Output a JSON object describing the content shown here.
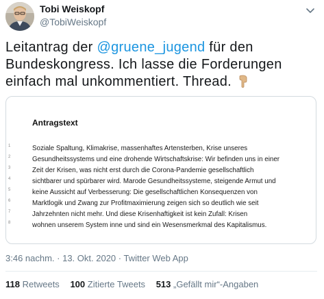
{
  "user": {
    "name": "Tobi Weiskopf",
    "handle": "@TobiWeiskopf"
  },
  "tweet": {
    "text_before": "Leitantrag der ",
    "mention": "@gruene_jugend",
    "text_after": " für den Bundeskongress. Ich lasse die Forderungen einfach mal unkommentiert. Thread.",
    "emoji": "finger-down-emoji"
  },
  "document": {
    "title": "Antragstext",
    "lines": [
      {
        "num": "1",
        "text": "Soziale Spaltung, Klimakrise, massenhaftes Artensterben, Krise unseres"
      },
      {
        "num": "2",
        "text": "Gesundheitssystems und eine drohende Wirtschaftskrise: Wir befinden uns in einer"
      },
      {
        "num": "3",
        "text": "Zeit der Krisen, was nicht erst durch die Corona-Pandemie gesellschaftlich"
      },
      {
        "num": "4",
        "text": "sichtbarer und spürbarer wird. Marode Gesundheitssysteme, steigende Armut und"
      },
      {
        "num": "5",
        "text": "keine Aussicht auf Verbesserung: Die gesellschaftlichen Konsequenzen von"
      },
      {
        "num": "6",
        "text": "Marktlogik und Zwang zur Profitmaximierung zeigen sich so deutlich wie seit"
      },
      {
        "num": "7",
        "text": "Jahrzehnten nicht mehr. Und diese Krisenhaftigkeit ist kein Zufall: Krisen"
      },
      {
        "num": "8",
        "text": "wohnen unserem System inne und sind ein Wesensmerkmal des Kapitalismus."
      }
    ]
  },
  "meta": {
    "timestamp": "3:46 nachm. · 13. Okt. 2020 · Twitter Web App"
  },
  "stats": {
    "retweets_count": "118",
    "retweets_label": "Retweets",
    "quotes_count": "100",
    "quotes_label": "Zitierte Tweets",
    "likes_count": "513",
    "likes_label": "„Gefällt mir“-Angaben"
  },
  "colors": {
    "link": "#1b95e0",
    "secondary_text": "#657786"
  }
}
